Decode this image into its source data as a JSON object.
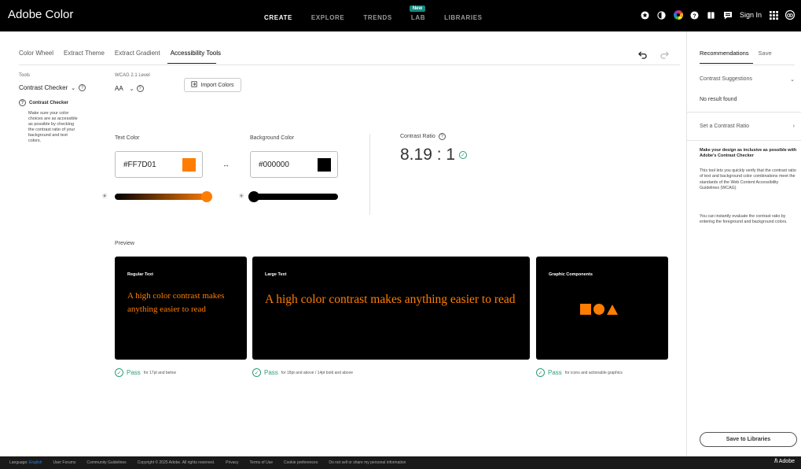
{
  "app": {
    "brand": "Adobe Color",
    "nav": [
      {
        "label": "CREATE",
        "active": true
      },
      {
        "label": "EXPLORE",
        "active": false
      },
      {
        "label": "TRENDS",
        "active": false
      },
      {
        "label": "LAB",
        "active": false,
        "badge": "New"
      },
      {
        "label": "LIBRARIES",
        "active": false
      }
    ],
    "sign_in": "Sign In"
  },
  "tabs": [
    {
      "label": "Color Wheel",
      "active": false
    },
    {
      "label": "Extract Theme",
      "active": false
    },
    {
      "label": "Extract Gradient",
      "active": false
    },
    {
      "label": "Accessibility Tools",
      "active": true
    }
  ],
  "tools": {
    "label": "Tools",
    "selected": "Contrast Checker",
    "heading": "Contrast Checker",
    "description": "Make sure your color choices are as accessible as possible by checking the contrast ratio of your background and text colors."
  },
  "wcag": {
    "label": "WCAG 2.1 Level",
    "selected": "AA"
  },
  "import_button": "Import Colors",
  "text_color": {
    "label": "Text Color",
    "value": "#FF7D01",
    "swatch": "#FF7D01",
    "brightness": 1.0
  },
  "background_color": {
    "label": "Background Color",
    "value": "#000000",
    "swatch": "#000000",
    "brightness": 0.0
  },
  "contrast": {
    "label": "Contrast Ratio",
    "value": "8.19 : 1"
  },
  "preview": {
    "label": "Preview",
    "cards": [
      {
        "title": "Regular Text",
        "text": "A high color contrast makes anything easier to read"
      },
      {
        "title": "Large Text",
        "text": "A high color contrast makes anything easier to read"
      },
      {
        "title": "Graphic Components"
      }
    ],
    "results": [
      {
        "status": "Pass",
        "note": "for 17pt and below"
      },
      {
        "status": "Pass",
        "note": "for 18pt and above / 14pt bold and above"
      },
      {
        "status": "Pass",
        "note": "for icons and actionable graphics"
      }
    ]
  },
  "right_panel": {
    "tabs": [
      {
        "label": "Recommendations",
        "active": true
      },
      {
        "label": "Save",
        "active": false
      }
    ],
    "contrast_suggestions": "Contrast Suggestions",
    "no_result": "No result found",
    "set_ratio": "Set a Contrast Ratio",
    "info_title": "Make your design as inclusive as possible with Adobe's Contrast Checker",
    "info_p1": "This tool lets you quickly verify that the contrast ratio of text and background color combinations meet the standards of the Web Content Accessibility Guidelines (WCAG)",
    "info_p2": "You can instantly evaluate the contrast ratio by entering the foreground and background colors.",
    "save_button": "Save to Libraries"
  },
  "footer": {
    "language_label": "Language:",
    "language": "English",
    "links": [
      "User Forums",
      "Community Guidelines",
      "Copyright © 2025 Adobe. All rights reserved.",
      "Privacy",
      "Terms of Use",
      "Cookie preferences",
      "Do not sell or share my personal information"
    ],
    "adobe": "Adobe"
  },
  "colors": {
    "accent": "#FF7D01",
    "pass": "#2d9d78",
    "lab_badge": "#158a7f"
  }
}
